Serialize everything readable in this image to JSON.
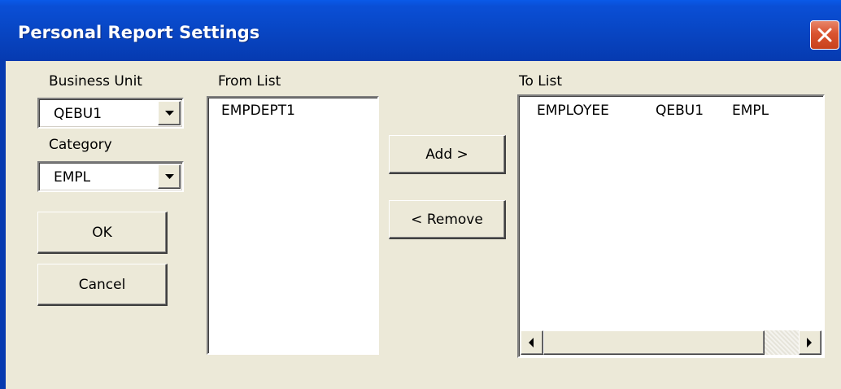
{
  "window": {
    "title": "Personal Report Settings"
  },
  "business_unit": {
    "label": "Business Unit",
    "value": "QEBU1"
  },
  "category": {
    "label": "Category",
    "value": "EMPL"
  },
  "buttons": {
    "ok": "OK",
    "cancel": "Cancel",
    "add": "Add >",
    "remove": "< Remove"
  },
  "from_list": {
    "label": "From List",
    "items": [
      "EMPDEPT1"
    ]
  },
  "to_list": {
    "label": "To List",
    "items": [
      {
        "name": "EMPLOYEE",
        "unit": "QEBU1",
        "category": "EMPL"
      }
    ]
  },
  "colors": {
    "titlebar": "#0846c4",
    "dialog_bg": "#ece9d8",
    "close_button": "#d9532f"
  },
  "icons": {
    "close": "close-icon",
    "dropdown": "chevron-down-icon",
    "scroll_left": "scroll-left-arrow-icon",
    "scroll_right": "scroll-right-arrow-icon"
  }
}
